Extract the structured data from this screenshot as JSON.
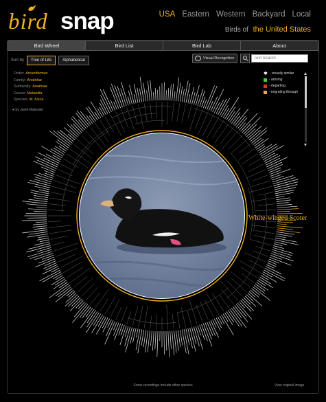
{
  "logo": {
    "part1": "bird",
    "part2": "snap"
  },
  "region_nav": [
    "USA",
    "Eastern",
    "Western",
    "Backyard",
    "Local"
  ],
  "region_active": "USA",
  "birds_of": {
    "prefix": "Birds of",
    "country": "the United States"
  },
  "tabs": [
    "Bird Wheel",
    "Bird List",
    "Bird Lab",
    "About"
  ],
  "sort": {
    "label": "Sort by",
    "options": [
      "Tree of Life",
      "Alphabetical"
    ],
    "active": "Tree of Life"
  },
  "visual_recognition_label": "Visual Recognition",
  "search": {
    "placeholder": "Text Search"
  },
  "taxonomy": [
    {
      "rank": "Order:",
      "value": "Anseriformes"
    },
    {
      "rank": "Family:",
      "value": "Anatidae"
    },
    {
      "rank": "Subfamily:",
      "value": "Anatinae"
    },
    {
      "rank": "Genus:",
      "value": "Melanitta"
    },
    {
      "rank": "Species:",
      "value": "M. fusca"
    }
  ],
  "credit": "by Jarek Matusiak",
  "legend": [
    {
      "label": "- visually similar",
      "color": "#ffffff",
      "icon": "star-icon"
    },
    {
      "label": "- arriving",
      "color": "#44cc44",
      "icon": "arrow-icon"
    },
    {
      "label": "- departing",
      "color": "#dd3322",
      "icon": "arrow-icon"
    },
    {
      "label": "- migrating through",
      "color": "#f0b020",
      "icon": "arrow-icon"
    }
  ],
  "selected_species": "White-winged Scoter",
  "footer_note": "Some recordings include other species",
  "view_original": "View original image",
  "colors": {
    "accent": "#f0b020",
    "background": "#000000"
  }
}
